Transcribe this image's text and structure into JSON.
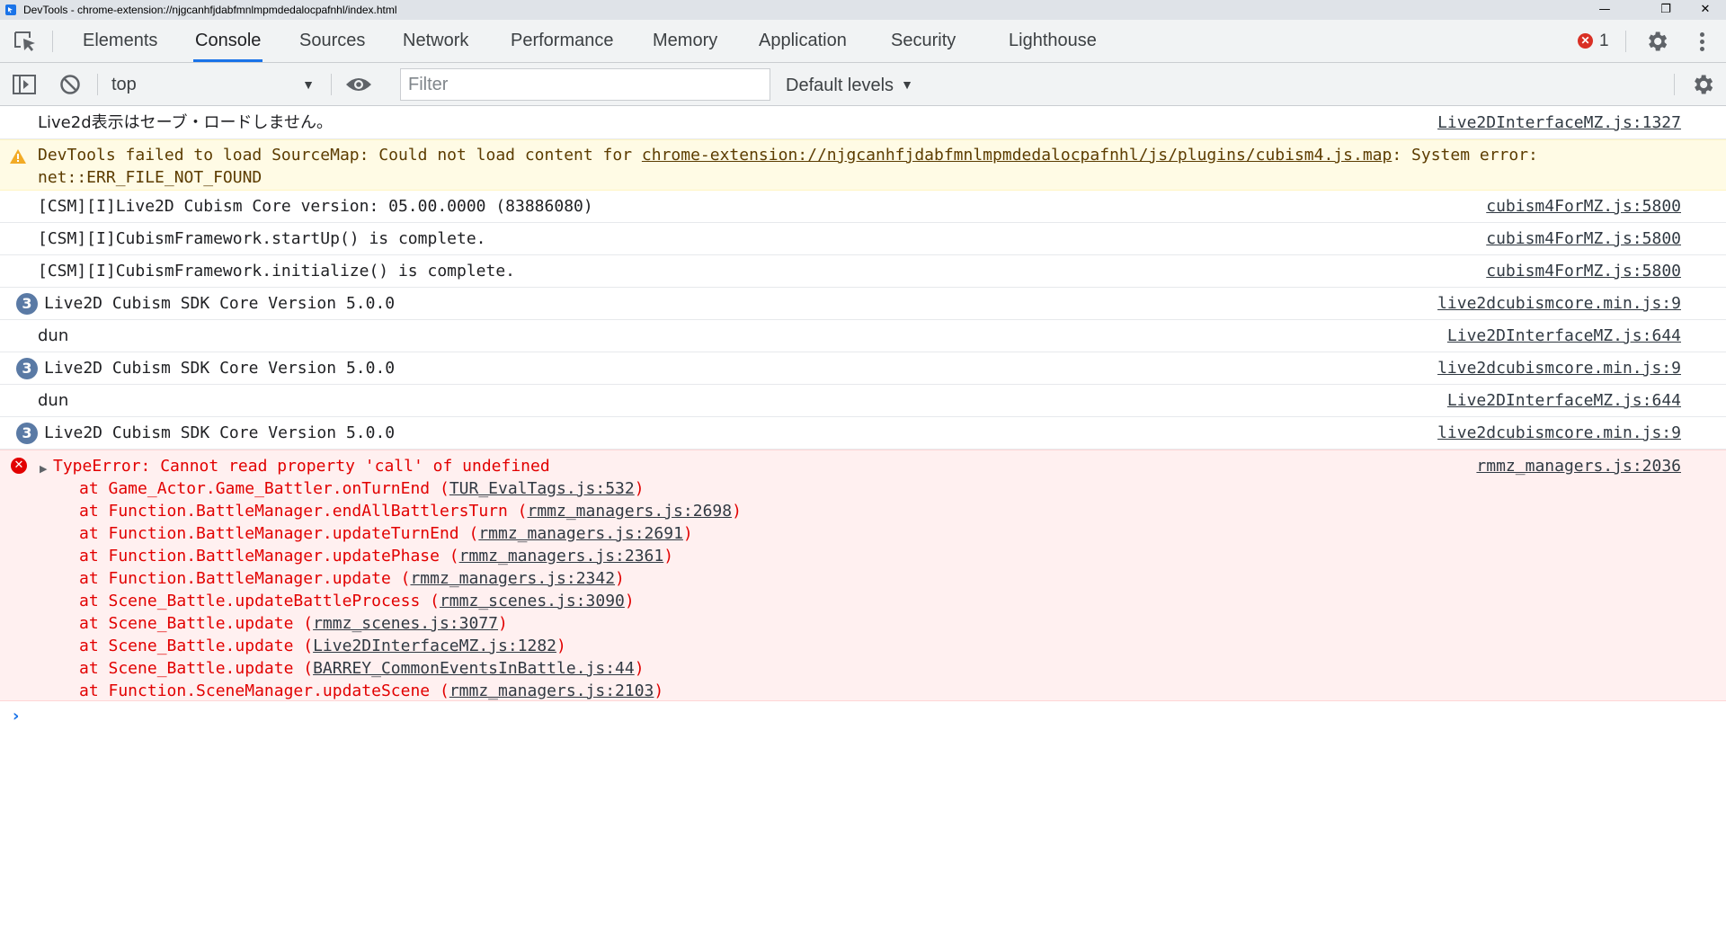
{
  "window": {
    "title": "DevTools - chrome-extension://njgcanhfjdabfmnlmpmdedalocpafnhl/index.html",
    "minimize": "—",
    "restore": "❐",
    "close": "✕"
  },
  "tabs": [
    "Elements",
    "Console",
    "Sources",
    "Network",
    "Performance",
    "Memory",
    "Application",
    "Security",
    "Lighthouse"
  ],
  "active_tab": "Console",
  "error_count": "1",
  "toolbar": {
    "context": "top",
    "filter_placeholder": "Filter",
    "levels": "Default levels"
  },
  "messages": {
    "m1": {
      "text": "Live2d表示はセーブ・ロードしません。",
      "source": "Live2DInterfaceMZ.js:1327"
    },
    "warn": {
      "prefix": "DevTools failed to load SourceMap: Could not load content for ",
      "link": "chrome-extension://njgcanhfjdabfmnlmpmdedalocpafnhl/js/plugins/cubism4.js.map",
      "suffix": ": System error:",
      "line2": "net::ERR_FILE_NOT_FOUND"
    },
    "m3": {
      "text": "[CSM][I]Live2D Cubism Core version: 05.00.0000 (83886080)",
      "source": "cubism4ForMZ.js:5800"
    },
    "m4": {
      "text": "[CSM][I]CubismFramework.startUp() is complete.",
      "source": "cubism4ForMZ.js:5800"
    },
    "m5": {
      "text": "[CSM][I]CubismFramework.initialize() is complete.",
      "source": "cubism4ForMZ.js:5800"
    },
    "m6": {
      "badge": "3",
      "text": "Live2D Cubism SDK Core Version 5.0.0",
      "source": "live2dcubismcore.min.js:9"
    },
    "m7": {
      "text": "dun",
      "source": "Live2DInterfaceMZ.js:644"
    },
    "m8": {
      "badge": "3",
      "text": "Live2D Cubism SDK Core Version 5.0.0",
      "source": "live2dcubismcore.min.js:9"
    },
    "m9": {
      "text": "dun",
      "source": "Live2DInterfaceMZ.js:644"
    },
    "m10": {
      "badge": "3",
      "text": "Live2D Cubism SDK Core Version 5.0.0",
      "source": "live2dcubismcore.min.js:9"
    }
  },
  "error": {
    "expander": "▶",
    "message": "TypeError: Cannot read property 'call' of undefined",
    "source": "rmmz_managers.js:2036",
    "stack": [
      {
        "fn": "at Game_Actor.Game_Battler.onTurnEnd (",
        "loc": "TUR_EvalTags.js:532"
      },
      {
        "fn": "at Function.BattleManager.endAllBattlersTurn (",
        "loc": "rmmz_managers.js:2698"
      },
      {
        "fn": "at Function.BattleManager.updateTurnEnd (",
        "loc": "rmmz_managers.js:2691"
      },
      {
        "fn": "at Function.BattleManager.updatePhase (",
        "loc": "rmmz_managers.js:2361"
      },
      {
        "fn": "at Function.BattleManager.update (",
        "loc": "rmmz_managers.js:2342"
      },
      {
        "fn": "at Scene_Battle.updateBattleProcess (",
        "loc": "rmmz_scenes.js:3090"
      },
      {
        "fn": "at Scene_Battle.update (",
        "loc": "rmmz_scenes.js:3077"
      },
      {
        "fn": "at Scene_Battle.update (",
        "loc": "Live2DInterfaceMZ.js:1282"
      },
      {
        "fn": "at Scene_Battle.update (",
        "loc": "BARREY_CommonEventsInBattle.js:44"
      },
      {
        "fn": "at Function.SceneManager.updateScene (",
        "loc": "rmmz_managers.js:2103"
      }
    ],
    "close_paren": ")"
  },
  "prompt": "›",
  "icons": {
    "app": "devtools-icon",
    "inspect": "inspect-element-icon",
    "settings": "gear-icon",
    "more": "kebab-menu-icon",
    "sidebar": "sidebar-toggle-icon",
    "clear": "clear-console-icon",
    "eye": "live-expression-icon",
    "warning": "warning-icon",
    "error": "error-icon"
  },
  "colors": {
    "accent": "#1a73e8",
    "error": "#e20000",
    "warning_bg": "#fffbe5",
    "error_bg": "#fff0f0"
  }
}
